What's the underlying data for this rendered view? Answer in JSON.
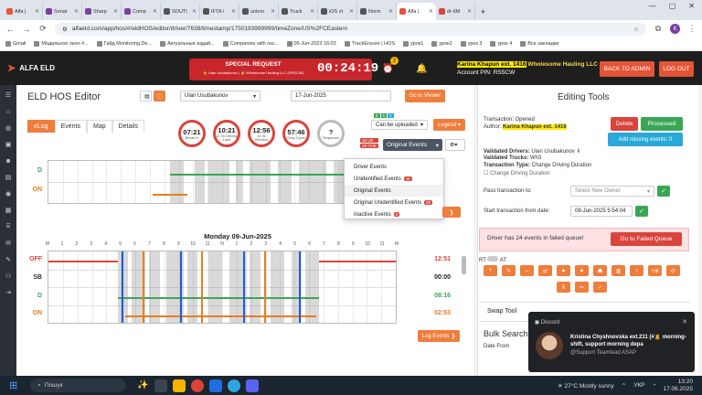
{
  "browser": {
    "tabs": [
      {
        "label": "Alfa |",
        "color": "#e25536"
      },
      {
        "label": "Sonat",
        "color": "#7b3fa0"
      },
      {
        "label": "Sharp",
        "color": "#7b3fa0"
      },
      {
        "label": "Comp",
        "color": "#7b3fa0"
      },
      {
        "label": "SOUTI",
        "color": "#555"
      },
      {
        "label": "IFTA /",
        "color": "#555"
      },
      {
        "label": "unkno",
        "color": "#555"
      },
      {
        "label": "Truck",
        "color": "#555"
      },
      {
        "label": "iOS vt",
        "color": "#555"
      },
      {
        "label": "Norm",
        "color": "#555"
      },
      {
        "label": "Alfa |",
        "color": "#e25536",
        "active": true
      },
      {
        "label": "dr-6M",
        "color": "#d9453c"
      }
    ],
    "url": "alfaeld.com/app/hos/#/eldHOS/editor/driver/7638/timestamp/1750193999999/timeZone/US%2FCEastern",
    "profile": "K",
    "bookmarks": [
      "Gmail",
      "Модальное окно #...",
      "Гайд Monitoring De...",
      "Актуальные издай...",
      "Companies with res...",
      "05-Jun-2023 16:03",
      "TrackEnsure | HOS",
      "урок1",
      "урок2",
      "урок 3",
      "урок 4",
      "Все закладки"
    ]
  },
  "header": {
    "brand": "ALFA ELD",
    "special_title": "SPECIAL REQUEST",
    "special_sub": "🔒 Ulan Usubakunov | 🔒 Wholesome Hauling LLC (RSSCW)",
    "timer": "00:24:19",
    "notif_count": "2",
    "user": "Karina Khapun ext. 1416",
    "company": "Wholesome Hauling LLC",
    "account": "Account PIN: RS5CW",
    "admin_label": "BACK TO ADMIN",
    "logout_label": "LOG OUT"
  },
  "editor": {
    "title": "ELD HOS Editor",
    "driver": "Ulan Usubakunov",
    "date": "17-Jun-2025",
    "goto_viewer": "Go to Viewer",
    "tabs": [
      "eLog",
      "Events",
      "Map",
      "Details"
    ],
    "gauges": [
      {
        "value": "07:21",
        "label": "Break in"
      },
      {
        "value": "10:21",
        "label": "11 Hr Driving Limit"
      },
      {
        "value": "12:56",
        "label": "14 Hr Window"
      },
      {
        "value": "57:46",
        "label": "Duty Cycle"
      },
      {
        "value": "?",
        "label": "Sequence"
      }
    ],
    "upload_select": "Can be uploaded",
    "upload_badges": [
      "6",
      "5",
      "0"
    ],
    "legend": "Legend",
    "ok_badges": [
      "16 UE",
      "28 OUE"
    ],
    "events_select": "Original Events",
    "dropdown": [
      {
        "label": "Driver Events"
      },
      {
        "label": "Unidentified Events",
        "badge": "16"
      },
      {
        "label": "Original Events",
        "selected": true
      },
      {
        "label": "Original Unidentified Events",
        "badge": "28"
      },
      {
        "label": "Inactive Events",
        "badge": "0"
      }
    ],
    "graph_labels": [
      "OFF",
      "SB",
      "D",
      "ON"
    ],
    "hours": [
      "M",
      "1",
      "2",
      "3",
      "4",
      "5",
      "6",
      "7",
      "8",
      "9",
      "10",
      "11",
      "N",
      "1",
      "2",
      "3",
      "4",
      "5",
      "6",
      "7",
      "8",
      "9",
      "10",
      "11",
      "M"
    ],
    "day2_title": "Monday 09-Jun-2025",
    "day2_totals": [
      "12:51",
      "00:00",
      "08:16",
      "02:53"
    ],
    "log_events": "Log Events"
  },
  "panel": {
    "title": "Editing Tools",
    "tx_status": "Transaction: Opened",
    "author": "Author:",
    "author_name": "Karina Khapun ext. 1416",
    "delete": "Delete",
    "processed": "Processed",
    "missing": "Add missing events: 0",
    "validated_drivers": "Validated Drivers:",
    "validated_driver_name": "Ulan Usubakunov",
    "validated_trucks": "Validated Trucks:",
    "validated_truck_num": "Wh3",
    "tx_type": "Transaction Type:",
    "tx_type_val": "Change Driving Duration",
    "tx_check": "Change Driving Duration",
    "pass_to": "Pass transaction to:",
    "owner_ph": "Select New Owner",
    "start_date_lbl": "Start transaction from date:",
    "start_date": "08-Jun-2025 5:54:04",
    "warning": "Driver has 24 events in failed queue!",
    "fail_btn": "Go to Failed Queue",
    "rt": "RT",
    "at": "AT",
    "swap": "Swap Tool",
    "bulk": "Bulk Search",
    "date_from": "Date From"
  },
  "toast": {
    "app": "Discord",
    "title": "Kristina Chyshnovska ext.211 (#🙎‍ morning-shift, support morning depa",
    "sub": "@Support Teamlead ASAP"
  },
  "taskbar": {
    "search": "Пошук",
    "weather": "27°C  Mostly sunny",
    "lang": "УКР",
    "time": "13:20",
    "date": "17.06.2025"
  }
}
